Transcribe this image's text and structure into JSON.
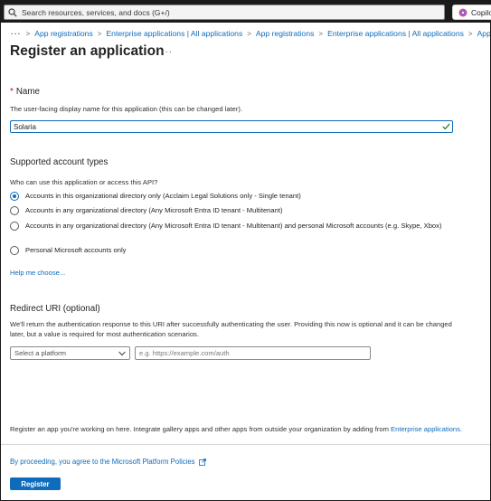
{
  "topbar": {
    "search_placeholder": "Search resources, services, and docs (G+/)",
    "copilot_label": "Copilot"
  },
  "breadcrumb": {
    "items": [
      "App registrations",
      "Enterprise applications | All applications",
      "App registrations",
      "Enterprise applications | All applications",
      "App"
    ]
  },
  "page": {
    "title": "Register an application",
    "more": "···"
  },
  "name_section": {
    "label": "Name",
    "description": "The user-facing display name for this application (this can be changed later).",
    "value": "Solaria"
  },
  "account_types": {
    "heading": "Supported account types",
    "question": "Who can use this application or access this API?",
    "options": [
      {
        "label": "Accounts in this organizational directory only (Acclaim Legal Solutions only - Single tenant)",
        "selected": true
      },
      {
        "label": "Accounts in any organizational directory (Any Microsoft Entra ID tenant - Multitenant)",
        "selected": false
      },
      {
        "label": "Accounts in any organizational directory (Any Microsoft Entra ID tenant - Multitenant) and personal Microsoft accounts (e.g. Skype, Xbox)",
        "selected": false
      },
      {
        "label": "Personal Microsoft accounts only",
        "selected": false
      }
    ],
    "help_link": "Help me choose..."
  },
  "redirect": {
    "heading": "Redirect URI (optional)",
    "description": "We'll return the authentication response to this URI after successfully authenticating the user. Providing this now is optional and it can be changed later, but a value is required for most authentication scenarios.",
    "platform_placeholder": "Select a platform",
    "uri_placeholder": "e.g. https://example.com/auth"
  },
  "footer_note": {
    "text": "Register an app you're working on here. Integrate gallery apps and other apps from outside your organization by adding from ",
    "link": "Enterprise applications."
  },
  "policy": {
    "link": "By proceeding, you agree to the Microsoft Platform Policies"
  },
  "actions": {
    "register": "Register"
  },
  "colors": {
    "accent": "#0f6cbd",
    "topbar": "#1b1b1b",
    "required": "#c50f1f"
  }
}
